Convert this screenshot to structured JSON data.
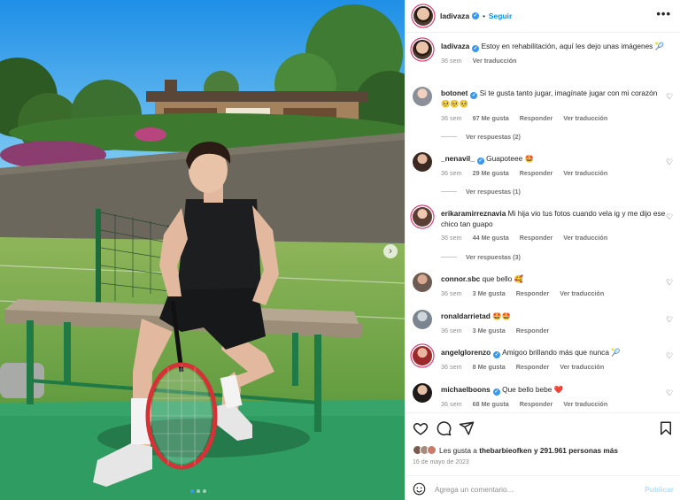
{
  "post": {
    "author": "ladivaza",
    "follow_label": "Seguir",
    "separator": "•",
    "more_label": "•••",
    "caption_text": "Estoy en rehabilitación, aquí les dejo unas imágenes",
    "caption_emoji": "🎾",
    "caption_time": "36 sem",
    "caption_translate": "Ver traducción",
    "carousel": {
      "count": 3,
      "active_index": 0,
      "next_label": "›"
    }
  },
  "comments": [
    {
      "user": "botonet",
      "verified": true,
      "text": "Si te gusta tanto jugar, imagínate jugar con mi corazón",
      "emoji": "🥺🥺🥺",
      "time": "36 sem",
      "likes": "97 Me gusta",
      "reply": "Responder",
      "translate": "Ver traducción",
      "view_replies": "Ver respuestas (2)"
    },
    {
      "user": "_nenavil_",
      "verified": true,
      "text": "Guapoteee",
      "emoji": "🤩",
      "time": "36 sem",
      "likes": "29 Me gusta",
      "reply": "Responder",
      "translate": "Ver traducción",
      "view_replies": "Ver respuestas (1)"
    },
    {
      "user": "erikaramirreznavia",
      "verified": false,
      "text": "Mi hija vio tus fotos cuando vela ig y me dijo ese chico tan guapo",
      "emoji": "",
      "time": "36 sem",
      "likes": "44 Me gusta",
      "reply": "Responder",
      "translate": "Ver traducción",
      "view_replies": "Ver respuestas (3)"
    },
    {
      "user": "connor.sbc",
      "verified": false,
      "text": "que bello",
      "emoji": "🥰",
      "time": "36 sem",
      "likes": "3 Me gusta",
      "reply": "Responder",
      "translate": "Ver traducción",
      "view_replies": ""
    },
    {
      "user": "ronaldarrietad",
      "verified": false,
      "text": "",
      "emoji": "🤩🤩",
      "time": "36 sem",
      "likes": "3 Me gusta",
      "reply": "Responder",
      "translate": "",
      "view_replies": ""
    },
    {
      "user": "angelglorenzo",
      "verified": true,
      "text": "Amigoo brillando más que nunca",
      "emoji": "🎾",
      "time": "36 sem",
      "likes": "8 Me gusta",
      "reply": "Responder",
      "translate": "Ver traducción",
      "view_replies": ""
    },
    {
      "user": "michaelboons",
      "verified": true,
      "text": "Que bello bebe",
      "emoji": "❤️",
      "time": "36 sem",
      "likes": "68 Me gusta",
      "reply": "Responder",
      "translate": "Ver traducción",
      "view_replies": ""
    }
  ],
  "actions": {
    "like_icon": "heart-icon",
    "comment_icon": "comment-icon",
    "share_icon": "send-icon",
    "save_icon": "bookmark-icon",
    "likes_prefix": "Les gusta a",
    "likes_user": "thebarbieofken",
    "likes_suffix": "y 291.961 personas más",
    "date": "16 de mayo de 2023"
  },
  "composer": {
    "emoji_icon": "smiley-icon",
    "placeholder": "Agrega un comentario...",
    "post_label": "Publicar"
  },
  "colors": {
    "link_blue": "#0095f6",
    "verified_blue": "#3897f0",
    "muted": "#8e8e8e",
    "court_green": "#2f9c62"
  }
}
